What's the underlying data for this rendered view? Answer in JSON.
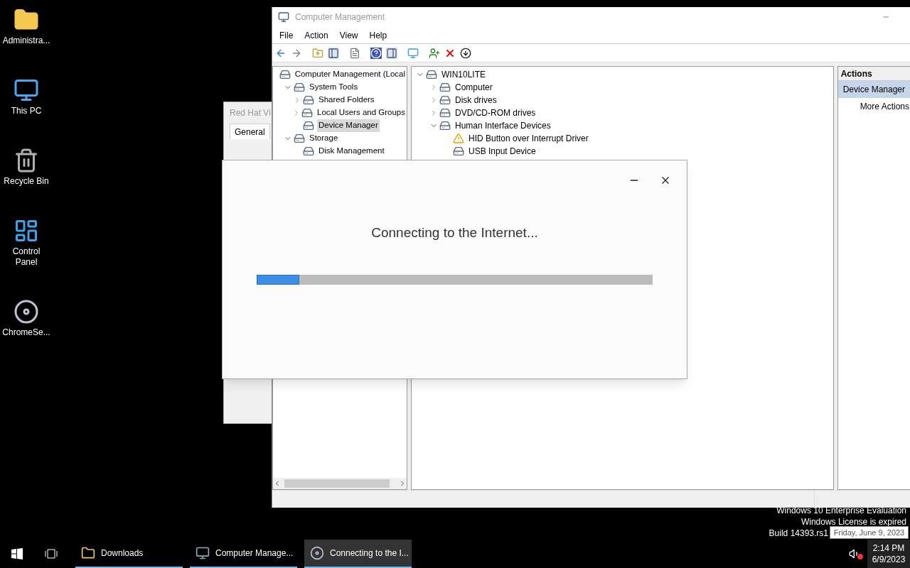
{
  "desktop_icons": [
    {
      "label": "Administra..."
    },
    {
      "label": "This PC"
    },
    {
      "label": "Recycle Bin"
    },
    {
      "label": "Control Panel"
    },
    {
      "label": "ChromeSe..."
    }
  ],
  "background_window": {
    "title": "Red Hat Vi",
    "tabs": [
      {
        "label": "General",
        "selected": true
      }
    ]
  },
  "computer_management": {
    "title": "Computer Management",
    "menu": [
      "File",
      "Action",
      "View",
      "Help"
    ],
    "tree": [
      {
        "label": "Computer Management (Local",
        "selected": false,
        "children": [
          {
            "label": "System Tools",
            "selected": false,
            "expanded": true,
            "children": [
              {
                "label": "Shared Folders",
                "selected": false,
                "expanded": false
              },
              {
                "label": "Local Users and Groups",
                "selected": false,
                "expanded": false
              },
              {
                "label": "Device Manager",
                "selected": true
              }
            ]
          },
          {
            "label": "Storage",
            "selected": false,
            "expanded": true,
            "children": [
              {
                "label": "Disk Management",
                "selected": false
              }
            ]
          }
        ]
      }
    ],
    "devices": [
      {
        "label": "WIN10LITE",
        "expanded": true,
        "warning": false,
        "children": [
          {
            "label": "Computer",
            "expanded": false,
            "warning": false
          },
          {
            "label": "Disk drives",
            "expanded": false,
            "warning": false
          },
          {
            "label": "DVD/CD-ROM drives",
            "expanded": false,
            "warning": false
          },
          {
            "label": "Human Interface Devices",
            "expanded": true,
            "warning": false,
            "children": [
              {
                "label": "HID Button over Interrupt Driver",
                "warning": true
              },
              {
                "label": "USB Input Device",
                "warning": false
              }
            ]
          }
        ]
      }
    ],
    "actions": {
      "header": "Actions",
      "items": [
        {
          "label": "Device Manager",
          "selected": true
        },
        {
          "label": "More Actions",
          "selected": false
        }
      ]
    }
  },
  "dialog": {
    "message": "Connecting to the Internet...",
    "progress": {
      "level": 0.107
    }
  },
  "system_notice": [
    "Windows 10 Enterprise Evaluation",
    "Windows License is expired",
    "Build 14393.rs1"
  ],
  "tooltip": "Friday, June 9, 2023",
  "taskbar": {
    "items": [
      {
        "label": "Downloads",
        "selected": false
      },
      {
        "label": "Computer Manage...",
        "selected": false
      },
      {
        "label": "Connecting to the I...",
        "selected": true
      }
    ],
    "clock": {
      "time": "2:14 PM",
      "date": "6/9/2023"
    }
  }
}
